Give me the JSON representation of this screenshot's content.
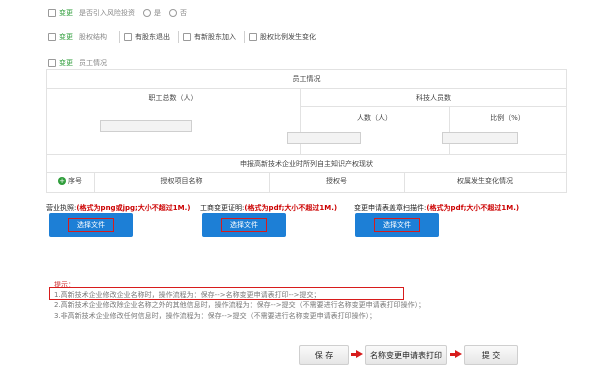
{
  "rows": {
    "row1": {
      "tag": "变更",
      "question": "是否引入风险投资",
      "opt_yes": "是",
      "opt_no": "否"
    },
    "row2": {
      "tag": "变更",
      "category": "股权结构",
      "items": [
        "有股东退出",
        "有新股东加入",
        "股权比例发生变化"
      ]
    },
    "row3": {
      "tag": "变更",
      "label": "员工情况"
    }
  },
  "staff_table": {
    "title": "员工情况",
    "total_header": "职工总数（人）",
    "tech_header": "科技人员数",
    "count_header": "人数（人）",
    "ratio_header": "比例（%）"
  },
  "ip_table": {
    "title": "申报高新技术企业时所列自主知识产权现状",
    "columns": [
      "序号",
      "授权项目名称",
      "授权号",
      "权属发生变化情况"
    ]
  },
  "uploads": [
    {
      "label": "营业执照:",
      "hint": "(格式为png或jpg;大小不超过1M.)",
      "button": "选择文件"
    },
    {
      "label": "工商变更证明:",
      "hint": "(格式为pdf;大小不超过1M.)",
      "button": "选择文件"
    },
    {
      "label": "变更申请表盖章扫描件:",
      "hint": "(格式为pdf;大小不超过1M.)",
      "button": "选择文件"
    }
  ],
  "tips": {
    "title": "提示：",
    "line1": "1.高新技术企业修改企业名称时，操作流程为：保存-->名称变更申请表打印-->提交；",
    "line2": "2.高新技术企业修改除企业名称之外的其他信息时，操作流程为：保存-->提交（不需要进行名称变更申请表打印操作）；",
    "line3": "3.非高新技术企业修改任何信息时，操作流程为：保存-->提交（不需要进行名称变更申请表打印操作）；"
  },
  "actions": {
    "save": "保 存",
    "print": "名称变更申请表打印",
    "submit": "提 交"
  },
  "colors": {
    "accent": "#1d7fd6",
    "highlight": "#d71c1c",
    "add": "#2e9d3a"
  }
}
